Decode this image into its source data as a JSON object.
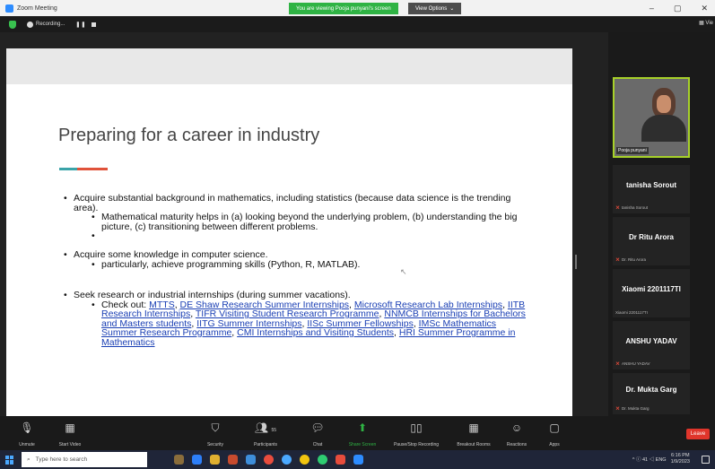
{
  "window": {
    "title": "Zoom Meeting",
    "viewing_banner": "You are viewing Pooja punyani's screen",
    "view_options": "View Options",
    "controls": [
      "–",
      "▢",
      "✕"
    ]
  },
  "top_toolbar": {
    "recording_label": "Recording...",
    "pause": "❚❚",
    "view_label": "Vie"
  },
  "slide": {
    "title": "Preparing for a career in industry",
    "bullets": {
      "b1": "Acquire substantial background in mathematics, including statistics (because data science is the trending area).",
      "b1_sub1": "Mathematical maturity helps in (a) looking beyond the underlying problem, (b) understanding the big picture, (c) transitioning between different problems.",
      "b1_sub2": "",
      "b2": "Acquire some knowledge in computer science.",
      "b2_sub1": "particularly, achieve programming skills  (Python, R, MATLAB).",
      "b3": "Seek research or industrial internships (during summer vacations).",
      "b3_sub_prefix": "Check out: ",
      "links": {
        "l1": "MTTS",
        "l2": "DE Shaw Research Summer Internships",
        "l3": "Microsoft Research Lab Internships",
        "l4": "IITB Research Internships",
        "l5": "TIFR Visiting Student Research Programme",
        "l6": "NNMCB Internships for Bachelors and Masters students",
        "l7": "IITG Summer Internships",
        "l8": "IISc Summer Fellowships",
        "l9": "IMSc Mathematics Summer Research Programme",
        "l10": "CMI Internships and Visiting Students",
        "l11": "HRI Summer Programme in Mathematics"
      }
    }
  },
  "participants": {
    "self": {
      "name": "Pooja punyani"
    },
    "list": [
      {
        "name": "tanisha Sorout",
        "sub": "tanisha Sorout",
        "muted": true
      },
      {
        "name": "Dr Ritu Arora",
        "sub": "Dr. Ritu Arora",
        "muted": true
      },
      {
        "name": "Xiaomi 2201117TI",
        "sub": "Xiaomi 2201117TI",
        "muted": false
      },
      {
        "name": "ANSHU YADAV",
        "sub": "ANSHU YADAV",
        "muted": true
      },
      {
        "name": "Dr. Mukta Garg",
        "sub": "Dr. Mukta Garg",
        "muted": true
      }
    ],
    "scroll_icon": "⌄"
  },
  "zoom_controls": {
    "unmute": "Unmute",
    "start_video": "Start Video",
    "security": "Security",
    "participants": "Participants",
    "participants_count": "55",
    "chat": "Chat",
    "share_screen": "Share Screen",
    "pause_recording": "Pause/Stop Recording",
    "breakout": "Breakout Rooms",
    "reactions": "Reactions",
    "apps": "Apps",
    "leave": "Leave"
  },
  "taskbar": {
    "search_placeholder": "Type here to search",
    "lang": "ENG",
    "time": "6:16 PM",
    "date": "1/9/2023",
    "tray_text": "^ ⓘ 41 ◁ ENG"
  },
  "colors": {
    "accent_teal": "#3aa3a8",
    "accent_red": "#e0523a",
    "link": "#1a3fb4",
    "leave_red": "#e0352b",
    "banner_green": "#2fb344",
    "self_border": "#a7d129"
  }
}
